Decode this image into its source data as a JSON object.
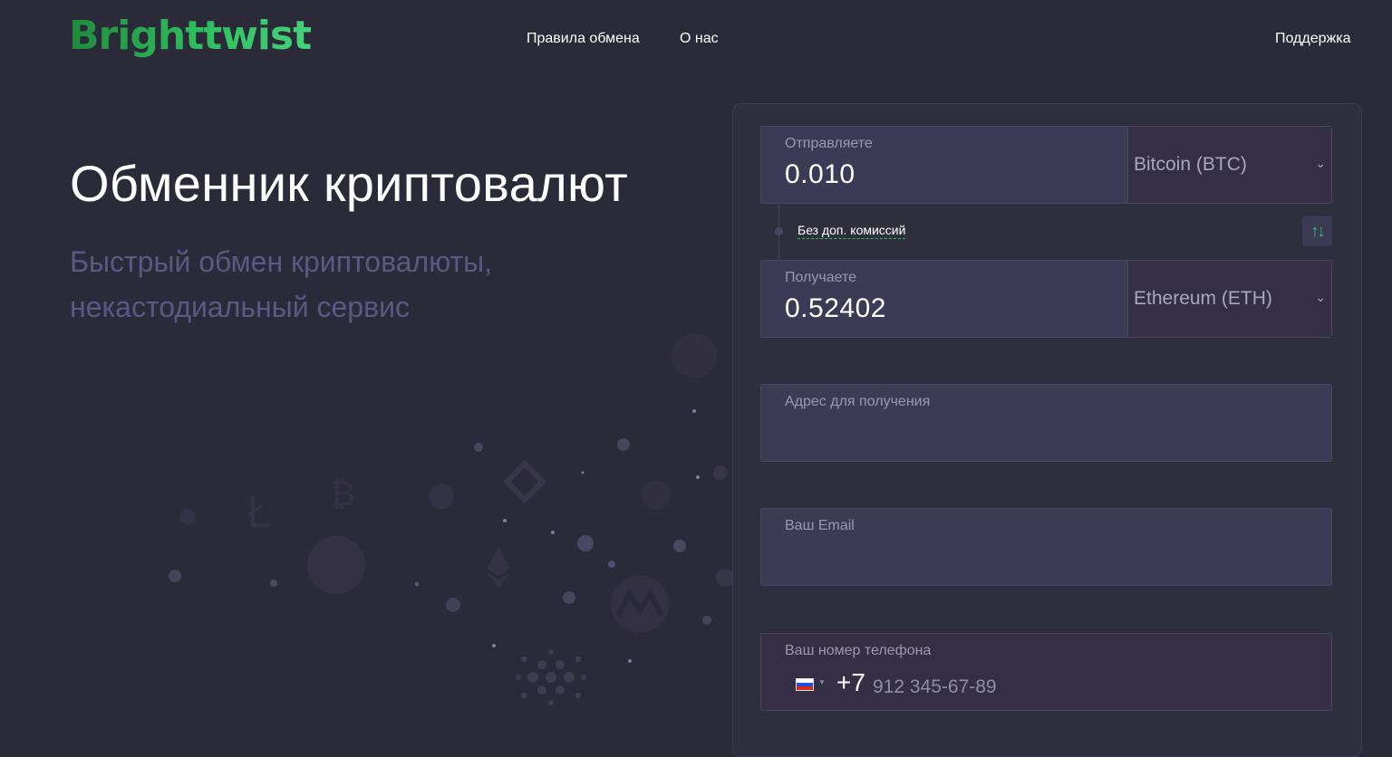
{
  "header": {
    "logo": "Brighttwist",
    "nav": [
      {
        "label": "Правила обмена"
      },
      {
        "label": "О нас"
      }
    ],
    "support": "Поддержка"
  },
  "hero": {
    "title": "Обменник криптовалют",
    "subtitle_line1": "Быстрый обмен криптовалюты,",
    "subtitle_line2": "некастодиальный сервис"
  },
  "exchange": {
    "send": {
      "label": "Отправляете",
      "amount": "0.010",
      "currency": "Bitcoin (BTC)"
    },
    "fee_note": "Без доп. комиссий",
    "receive": {
      "label": "Получаете",
      "amount": "0.52402",
      "currency": "Ethereum (ETH)"
    },
    "address": {
      "label": "Адрес для получения"
    },
    "email": {
      "label": "Ваш Email"
    },
    "phone": {
      "label": "Ваш номер телефона",
      "code": "+7",
      "placeholder": "912 345-67-89"
    }
  },
  "colors": {
    "background": "#2b2a38",
    "accent_green": "#2fbf5f",
    "subtitle": "#5b5885",
    "field_bg": "#3c3a55"
  },
  "icons": {
    "swap": "swap-arrows-icon",
    "select_arrow": "chevron-down-icon",
    "flag": "russia-flag-icon"
  }
}
